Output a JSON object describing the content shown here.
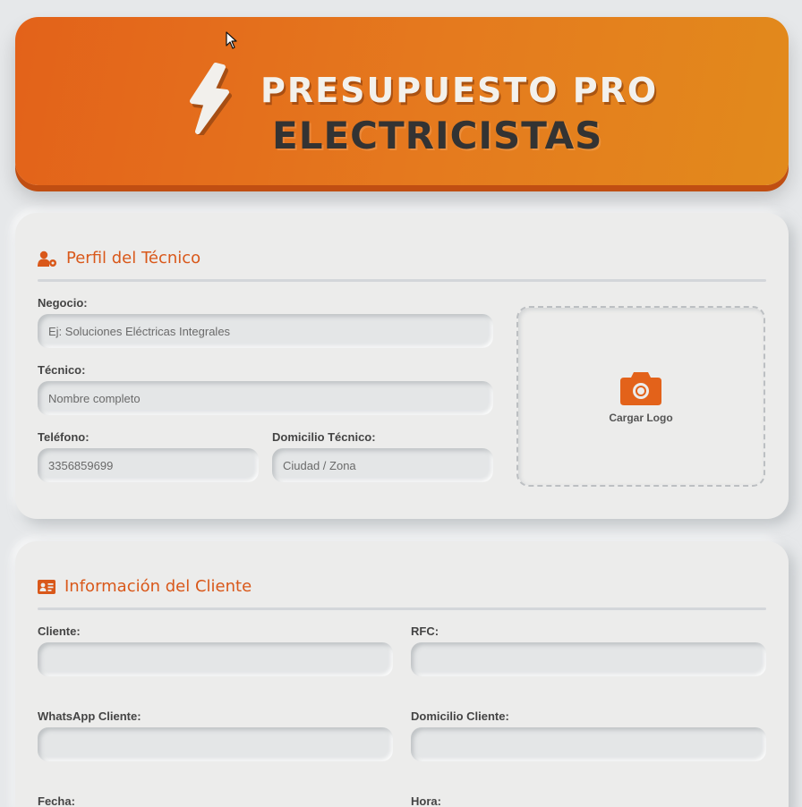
{
  "header": {
    "title_line1": "PRESUPUESTO PRO",
    "title_line2": "ELECTRICISTAS",
    "icon": "lightning-bolt-icon"
  },
  "profile": {
    "title": "Perfil del Técnico",
    "icon": "user-gear-icon",
    "fields": {
      "negocio": {
        "label": "Negocio:",
        "value": "",
        "placeholder": "Ej: Soluciones Eléctricas Integrales"
      },
      "tecnico": {
        "label": "Técnico:",
        "value": "",
        "placeholder": "Nombre completo"
      },
      "telefono": {
        "label": "Teléfono:",
        "value": "3356859699",
        "placeholder": ""
      },
      "domicilio": {
        "label": "Domicilio Técnico:",
        "value": "",
        "placeholder": "Ciudad / Zona"
      }
    },
    "logo_upload": {
      "label": "Cargar Logo",
      "icon": "camera-icon"
    }
  },
  "client": {
    "title": "Información del Cliente",
    "icon": "id-card-icon",
    "fields": {
      "cliente": {
        "label": "Cliente:",
        "value": ""
      },
      "rfc": {
        "label": "RFC:",
        "value": ""
      },
      "whatsapp": {
        "label": "WhatsApp Cliente:",
        "value": ""
      },
      "domicilio": {
        "label": "Domicilio Cliente:",
        "value": ""
      },
      "fecha": {
        "label": "Fecha:",
        "value": ""
      },
      "hora": {
        "label": "Hora:",
        "value": ""
      }
    }
  },
  "colors": {
    "accent": "#e3621a",
    "accent_dark": "#c04e12",
    "background": "#e6e8ea",
    "card": "#ececeb"
  }
}
